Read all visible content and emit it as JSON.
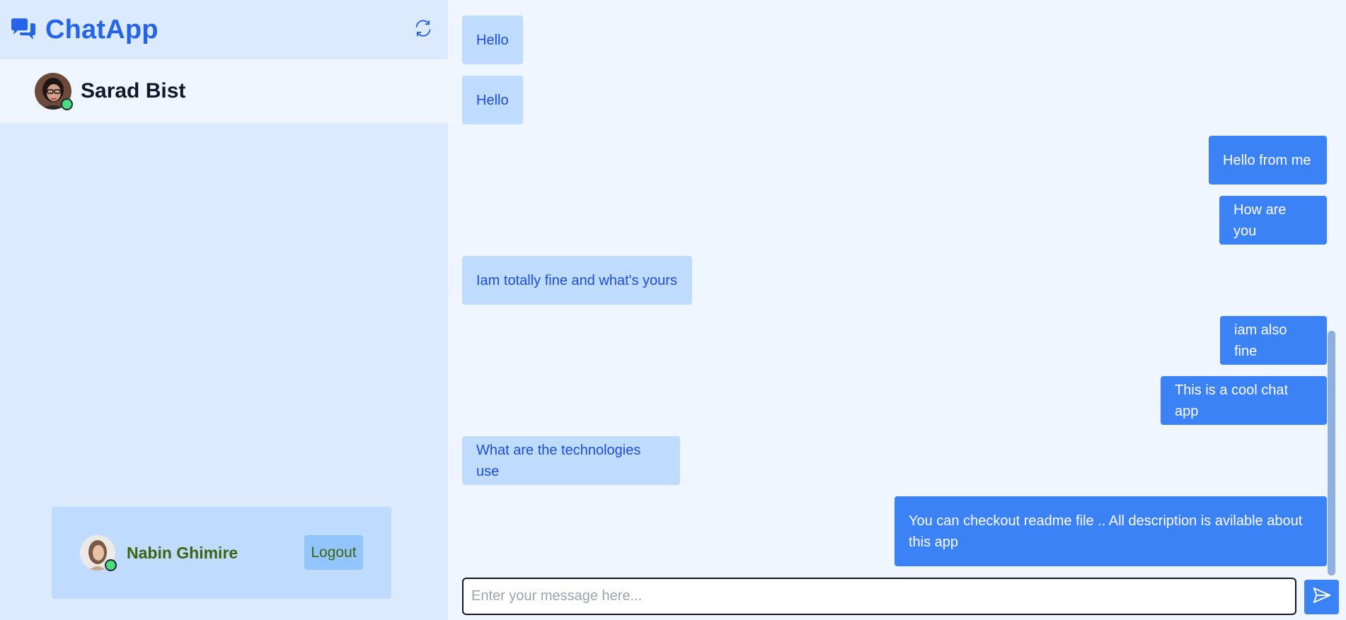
{
  "app": {
    "title": "ChatApp",
    "brand_icon": "chat-bubbles-icon",
    "refresh_icon": "refresh-icon",
    "accent_color": "#2563eb"
  },
  "contacts": [
    {
      "name": "Sarad Bist",
      "status": "online"
    }
  ],
  "current_user": {
    "name": "Nabin Ghimire",
    "status": "online",
    "logout_label": "Logout"
  },
  "messages": [
    {
      "text": "Hello",
      "direction": "incoming"
    },
    {
      "text": "Hello",
      "direction": "incoming"
    },
    {
      "text": "Hello from me",
      "direction": "outgoing"
    },
    {
      "text": "How are you",
      "direction": "outgoing"
    },
    {
      "text": "Iam totally fine and what's yours",
      "direction": "incoming"
    },
    {
      "text": "iam also fine",
      "direction": "outgoing"
    },
    {
      "text": "This is a cool chat app",
      "direction": "outgoing"
    },
    {
      "text": "What are the technologies use",
      "direction": "incoming"
    },
    {
      "text": "You can checkout readme file .. All description is avilable about this app",
      "direction": "outgoing"
    }
  ],
  "composer": {
    "placeholder": "Enter your message here...",
    "value": "",
    "send_icon": "send-icon"
  }
}
